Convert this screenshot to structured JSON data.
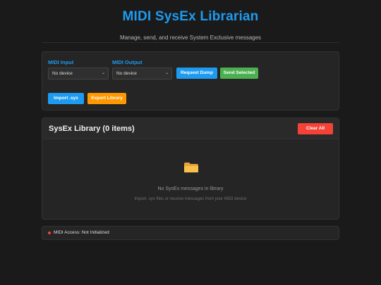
{
  "header": {
    "title": "MIDI SysEx Librarian",
    "subtitle": "Manage, send, and receive System Exclusive messages"
  },
  "controls": {
    "midi_input_label": "MIDI Input",
    "midi_input_value": "No device",
    "midi_output_label": "MIDI Output",
    "midi_output_value": "No device",
    "request_dump_label": "Request Dump",
    "send_selected_label": "Send Selected",
    "import_label": "Import .syx",
    "export_label": "Export Library"
  },
  "library": {
    "title": "SysEx Library (0 items)",
    "clear_all_label": "Clear All",
    "empty_icon": "folder-icon",
    "empty_title": "No SysEx messages in library",
    "empty_subtitle": "Import .syx files or receive messages from your MIDI device"
  },
  "status": {
    "text": "MIDI Access: Not Initialized",
    "indicator_color": "#f44336"
  },
  "colors": {
    "accent": "#1e9bf0",
    "green": "#4caf50",
    "orange": "#ff9800",
    "red": "#f44336",
    "background": "#1a1a1a"
  }
}
